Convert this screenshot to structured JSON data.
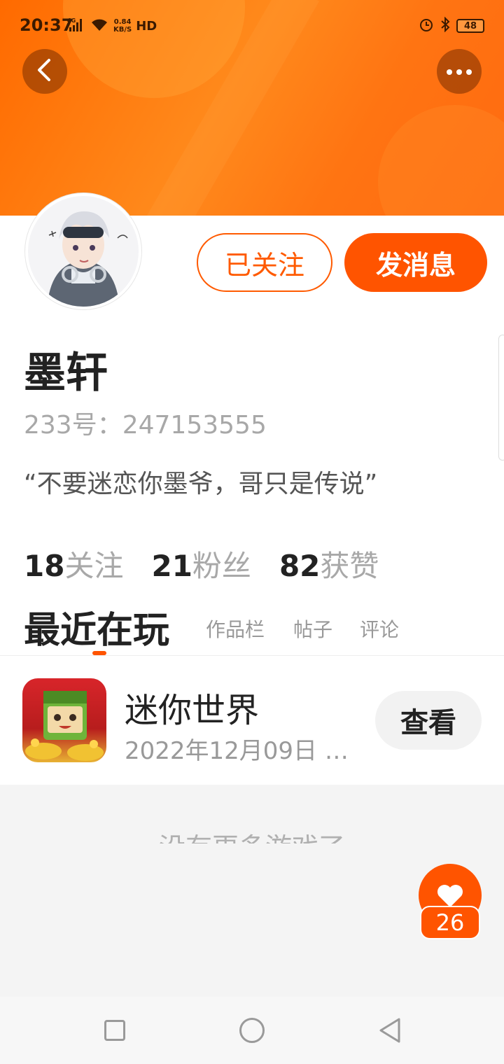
{
  "status_bar": {
    "time": "20:37",
    "network_type": "4G",
    "speed_value": "0.84",
    "speed_unit": "KB/S",
    "hd_label": "HD",
    "battery": "48"
  },
  "nav": {
    "back_icon": "chevron-left-icon",
    "more_icon": "more-horizontal-icon"
  },
  "profile": {
    "follow_button_label": "已关注",
    "message_button_label": "发消息",
    "username": "墨轩",
    "user_id": "233号：247153555",
    "bio": "“不要迷恋你墨爷，哥只是传说”",
    "stats": [
      {
        "count": "18",
        "label": "关注"
      },
      {
        "count": "21",
        "label": "粉丝"
      },
      {
        "count": "82",
        "label": "获赞"
      }
    ]
  },
  "tabs": {
    "active": "最近在玩",
    "items": [
      "作品栏",
      "帖子",
      "评论"
    ]
  },
  "games": [
    {
      "name": "迷你世界",
      "time": "2022年12月09日 1...",
      "action_label": "查看"
    }
  ],
  "empty_message": "没有更多游戏了",
  "like_fab": {
    "icon": "heart-icon",
    "count": "26"
  },
  "colors": {
    "accent": "#ff5400",
    "header": "#ff7a14"
  }
}
